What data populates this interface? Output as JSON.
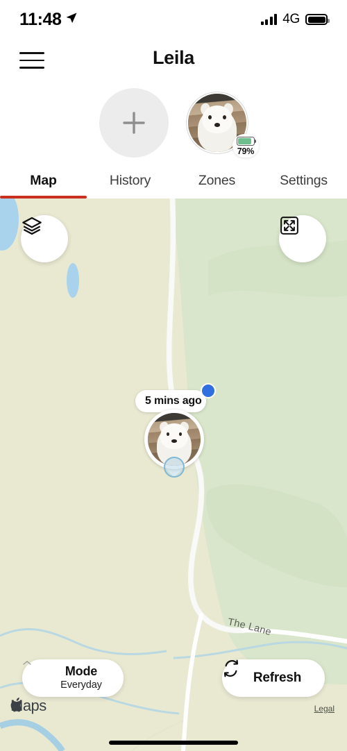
{
  "status_bar": {
    "time": "11:48",
    "location_icon": "location-arrow-icon",
    "signal_icon": "signal-bars-icon",
    "network": "4G",
    "battery_icon": "battery-full-icon"
  },
  "app_bar": {
    "menu_icon": "hamburger-menu-icon",
    "title": "Leila"
  },
  "pet_row": {
    "add_button": {
      "icon": "plus-icon",
      "label": "+"
    },
    "pet_avatar": {
      "name": "Leila",
      "battery_percent": "79%",
      "battery_level": 79,
      "battery_color": "#6fbf8e"
    }
  },
  "tabs": {
    "items": [
      {
        "label": "Map",
        "active": true
      },
      {
        "label": "History",
        "active": false
      },
      {
        "label": "Zones",
        "active": false
      },
      {
        "label": "Settings",
        "active": false
      }
    ],
    "active_indicator_color": "#c9301e"
  },
  "map": {
    "layers_button": {
      "icon": "layers-icon"
    },
    "expand_button": {
      "icon": "expand-arrows-icon"
    },
    "street_label": "The Lane",
    "marker": {
      "timestamp_label": "5 mins ago",
      "status_dot_color": "#2f6fe0",
      "accuracy_circle_color": "#7fb8d4"
    },
    "colors": {
      "land": "#e9e9d2",
      "park": "#d9e6cb",
      "water": "#a9d3ed",
      "road": "#ffffff",
      "stream": "#b9d8e2"
    }
  },
  "bottom_controls": {
    "mode": {
      "chevron_icon": "chevron-up-icon",
      "title": "Mode",
      "value": "Everyday"
    },
    "refresh": {
      "icon": "refresh-icon",
      "label": "Refresh"
    },
    "attribution": {
      "logo_icon": "apple-logo-icon",
      "label": "Maps"
    },
    "legal_link": "Legal"
  }
}
